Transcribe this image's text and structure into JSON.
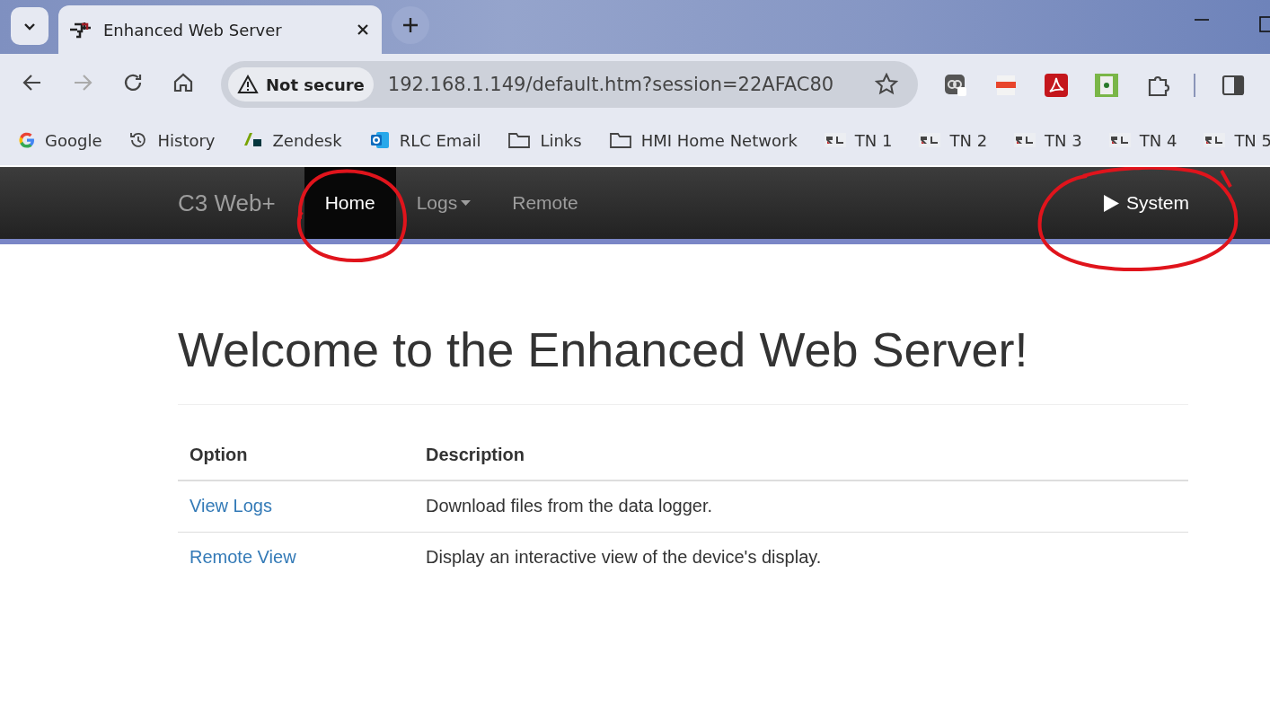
{
  "browser": {
    "tab_title": "Enhanced Web Server",
    "security_label": "Not secure",
    "url": "192.168.1.149/default.htm?session=22AFAC80",
    "bookmarks": [
      {
        "label": "Google",
        "kind": "google"
      },
      {
        "label": "History",
        "kind": "history"
      },
      {
        "label": "Zendesk",
        "kind": "zendesk"
      },
      {
        "label": "RLC Email",
        "kind": "outlook"
      },
      {
        "label": "Links",
        "kind": "folder"
      },
      {
        "label": "HMI Home Network",
        "kind": "folder"
      },
      {
        "label": "TN 1",
        "kind": "rl"
      },
      {
        "label": "TN 2",
        "kind": "rl"
      },
      {
        "label": "TN 3",
        "kind": "rl"
      },
      {
        "label": "TN 4",
        "kind": "rl"
      },
      {
        "label": "TN 5",
        "kind": "rl"
      }
    ]
  },
  "navbar": {
    "brand": "C3 Web+",
    "items": [
      {
        "label": "Home",
        "selected": true,
        "dropdown": false
      },
      {
        "label": "Logs",
        "selected": false,
        "dropdown": true
      },
      {
        "label": "Remote",
        "selected": false,
        "dropdown": false
      }
    ],
    "system": "System"
  },
  "page": {
    "heading": "Welcome to the Enhanced Web Server!",
    "columns": [
      "Option",
      "Description"
    ],
    "rows": [
      {
        "option": "View Logs",
        "description": "Download files from the data logger."
      },
      {
        "option": "Remote View",
        "description": "Display an interactive view of the device's display."
      }
    ]
  }
}
